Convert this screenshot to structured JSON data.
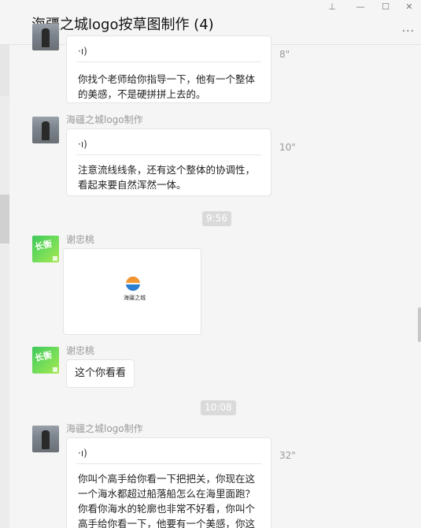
{
  "window": {
    "title": "海疆之城logo按草图制作 (4)",
    "pin": "⊥",
    "minimize": "—",
    "maximize": "☐",
    "close": "✕",
    "more": "..."
  },
  "messages": [
    {
      "sender": "",
      "voice_icon": "·ı)",
      "transcript": "你找个老师给你指导一下，他有一个整体的美感，不是硬拼拼上去的。",
      "duration": "8\""
    },
    {
      "sender": "海疆之城logo制作",
      "voice_icon": "·ı)",
      "transcript": "注意流线线条，还有这个整体的协调性，看起来要自然浑然一体。",
      "duration": "10\""
    },
    {
      "time": "9:56"
    },
    {
      "sender": "谢忠桃",
      "image_caption": "海疆之城"
    },
    {
      "sender": "谢忠桃",
      "text": "这个你看看"
    },
    {
      "time": "10:08"
    },
    {
      "sender": "海疆之城logo制作",
      "voice_icon": "·ı)",
      "transcript": "你叫个高手给你看一下把把关，你现在这一个海水都超过船落船怎么在海里面跑？你看你海水的轮廓也非常不好看，你叫个高手给你看一下，他要有一个美感，你这丑死了，哎呀，你",
      "duration": "32\""
    }
  ]
}
